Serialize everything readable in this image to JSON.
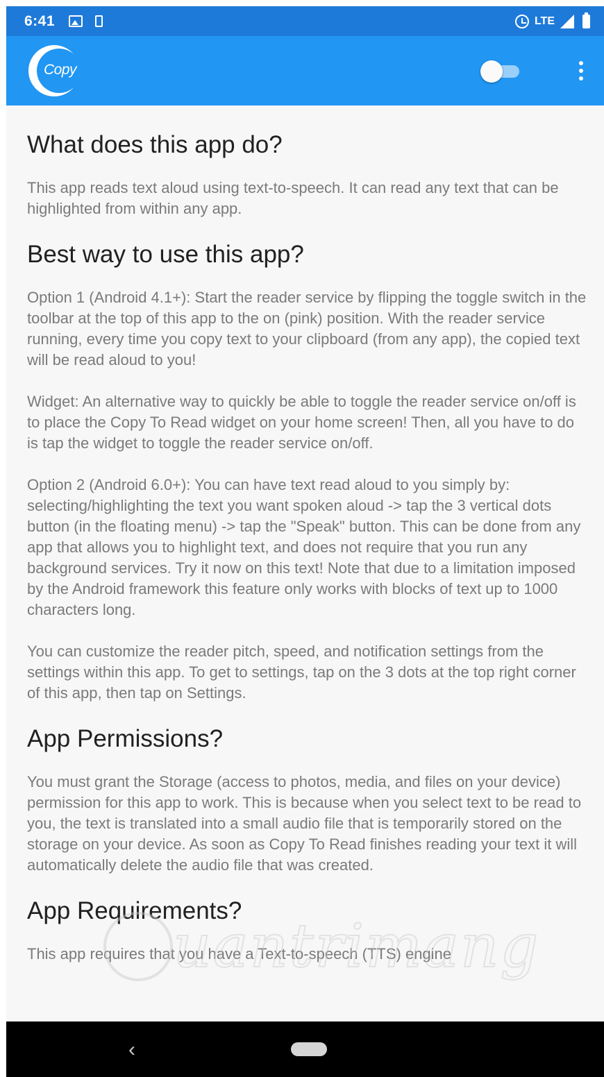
{
  "status_bar": {
    "time": "6:41",
    "network": "LTE"
  },
  "toolbar": {
    "logo_text": "Copy",
    "reader_toggle_on": false
  },
  "sections": [
    {
      "heading": "What does this app do?",
      "paragraphs": [
        "This app reads text aloud using text-to-speech. It can read any text that can be highlighted from within any app."
      ]
    },
    {
      "heading": "Best way to use this app?",
      "paragraphs": [
        "Option 1 (Android 4.1+): Start the reader service by flipping the toggle switch in the toolbar at the top of this app to the on (pink) position. With the reader service running, every time you copy text to your clipboard (from any app), the copied text will be read aloud to you!",
        "Widget: An alternative way to quickly be able to toggle the reader service on/off is to place the Copy To Read widget on your home screen! Then, all you have to do is tap the widget to toggle the reader service on/off.",
        "Option 2 (Android 6.0+): You can have text read aloud to you simply by: selecting/highlighting the text you want spoken aloud -> tap the 3 vertical dots button (in the floating menu) -> tap the \"Speak\" button. This can be done from any app that allows you to highlight text, and does not require that you run any background services. Try it now on this text! Note that due to a limitation imposed by the Android framework this feature only works with blocks of text up to 1000 characters long.",
        "You can customize the reader pitch, speed, and notification settings from the settings within this app. To get to settings, tap on the 3 dots at the top right corner of this app, then tap on Settings."
      ]
    },
    {
      "heading": "App Permissions?",
      "paragraphs": [
        "You must grant the Storage (access to photos, media, and files on your device) permission for this app to work. This is because when you select text to be read to you, the text is translated into a small audio file that is temporarily stored on the storage on your device. As soon as Copy To Read finishes reading your text it will automatically delete the audio file that was created."
      ]
    },
    {
      "heading": "App Requirements?",
      "paragraphs": [
        "This app requires that you have a Text-to-speech (TTS) engine"
      ]
    }
  ],
  "watermark": {
    "text": "uantrimang"
  },
  "nav_bar": {
    "back_glyph": "‹"
  },
  "colors": {
    "status_bar": "#1e7ad9",
    "toolbar": "#2196f3",
    "content_bg": "#f7f7f7",
    "heading": "#212121",
    "body_text": "#7a7a7a",
    "nav_bar": "#000000"
  },
  "icons": {
    "status_left": [
      "image-icon",
      "phone-icon"
    ],
    "status_right": [
      "alarm-icon",
      "signal-icon",
      "battery-icon"
    ],
    "toolbar": [
      "app-logo",
      "reader-toggle",
      "overflow-menu-icon"
    ],
    "nav": [
      "back-icon",
      "home-pill-icon"
    ]
  }
}
